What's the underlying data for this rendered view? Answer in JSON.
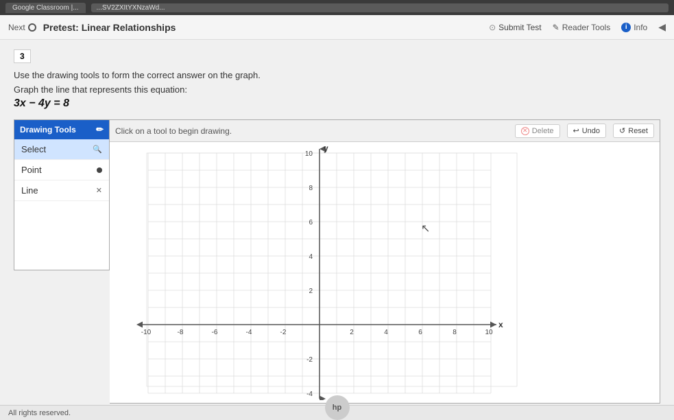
{
  "browser": {
    "tab_label": "Google Classroom |...",
    "url_text": "...SV2ZXItYXNzaWd..."
  },
  "header": {
    "nav_next": "Next",
    "title": "Pretest: Linear Relationships",
    "submit_label": "Submit Test",
    "reader_tools_label": "Reader Tools",
    "info_label": "Info"
  },
  "question": {
    "number": "3",
    "instructions": "Use the drawing tools to form the correct answer on the graph.",
    "graph_label": "Graph the line that represents this equation:",
    "equation": "3x − 4y = 8"
  },
  "drawing_tools": {
    "header": "Drawing Tools",
    "tools": [
      {
        "name": "Select",
        "icon": "🔍"
      },
      {
        "name": "Point",
        "icon": "•"
      },
      {
        "name": "Line",
        "icon": "✕"
      }
    ]
  },
  "graph_toolbar": {
    "instruction": "Click on a tool to begin drawing.",
    "delete_label": "Delete",
    "undo_label": "Undo",
    "reset_label": "Reset"
  },
  "graph": {
    "x_min": -10,
    "x_max": 10,
    "y_min": -6,
    "y_max": 10,
    "x_label": "x",
    "y_label": "y",
    "x_ticks": [
      -10,
      -8,
      -6,
      -4,
      -2,
      2,
      4,
      6,
      8,
      10
    ],
    "y_ticks": [
      -4,
      -2,
      2,
      4,
      6,
      8,
      10
    ]
  },
  "footer": {
    "copyright": "All rights reserved.",
    "hp_label": "hp"
  }
}
